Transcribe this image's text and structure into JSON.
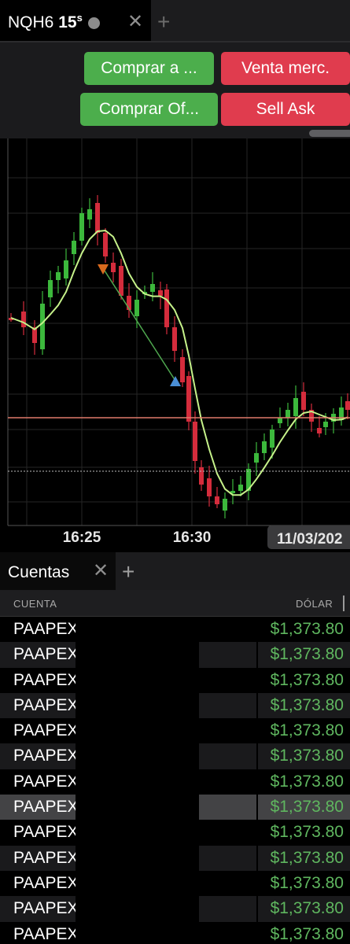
{
  "chart_tab": {
    "symbol": "NQH6",
    "interval": "15",
    "interval_unit": "s"
  },
  "order_buttons": {
    "buy_market": "Comprar a ...",
    "sell_market": "Venta merc.",
    "buy_bid": "Comprar Of...",
    "sell_ask": "Sell Ask"
  },
  "chart_data": {
    "type": "candlestick",
    "x_ticks": [
      "16:25",
      "16:30"
    ],
    "date_label": "11/03/202",
    "colors": {
      "up": "#3cb83c",
      "down": "#d42c3c",
      "moving_average": "#c6f28a",
      "trend_line": "#4fa84f",
      "horizontal_line": "#e07a6a",
      "dotted_line": "#bbbbbb",
      "marker_sell": "#d96a1e",
      "marker_buy": "#4a8fd6"
    }
  },
  "accounts": {
    "tab_label": "Cuentas",
    "col_account": "CUENTA",
    "col_dollar": "DÓLAR",
    "rows": [
      {
        "name": "PAAPEX",
        "value": "$1,373.80"
      },
      {
        "name": "PAAPEX",
        "value": "$1,373.80"
      },
      {
        "name": "PAAPEX",
        "value": "$1,373.80"
      },
      {
        "name": "PAAPEX",
        "value": "$1,373.80"
      },
      {
        "name": "PAAPEX",
        "value": "$1,373.80"
      },
      {
        "name": "PAAPEX",
        "value": "$1,373.80"
      },
      {
        "name": "PAAPEX",
        "value": "$1,373.80"
      },
      {
        "name": "PAAPEX",
        "value": "$1,373.80"
      },
      {
        "name": "PAAPEX",
        "value": "$1,373.80"
      },
      {
        "name": "PAAPEX",
        "value": "$1,373.80"
      },
      {
        "name": "PAAPEX",
        "value": "$1,373.80"
      },
      {
        "name": "PAAPEX",
        "value": "$1,373.80"
      },
      {
        "name": "PAAPEX",
        "value": "$1,373.80"
      }
    ],
    "selected_row": 7
  }
}
